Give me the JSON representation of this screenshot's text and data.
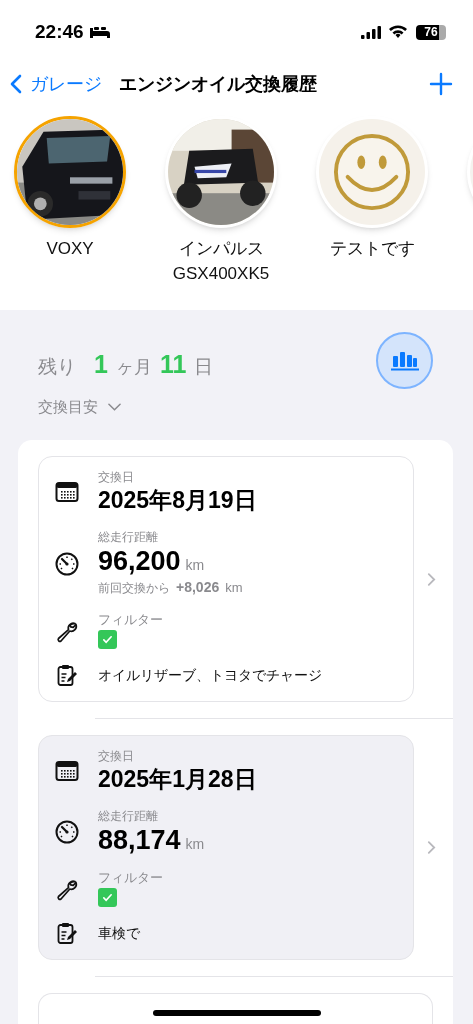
{
  "status_bar": {
    "time": "22:46",
    "battery": "76"
  },
  "nav": {
    "back": "ガレージ",
    "title": "エンジンオイル交換履歴"
  },
  "vehicles": [
    {
      "kind": "car",
      "name": "VOXY",
      "selected": true
    },
    {
      "kind": "bike",
      "name": "インパルス\nGSX400XK5",
      "selected": false
    },
    {
      "kind": "smiley",
      "name": "テストです",
      "selected": false
    },
    {
      "kind": "blank",
      "selected": false
    }
  ],
  "remaining": {
    "label": "残り",
    "months": "1",
    "month_unit": "ヶ月",
    "days": "11",
    "day_unit": "日"
  },
  "guide": {
    "label": "交換目安",
    "expanded": false
  },
  "records": [
    {
      "selected": false,
      "date_label": "交換日",
      "date": "2025年8月19日",
      "mileage_label": "総走行距離",
      "mileage": "96,200",
      "unit": "km",
      "since_label": "前回交換から",
      "since": "+8,026",
      "since_unit": "km",
      "filter_label": "フィルター",
      "filter_checked": true,
      "note": "オイルリザーブ、トヨタでチャージ"
    },
    {
      "selected": true,
      "date_label": "交換日",
      "date": "2025年1月28日",
      "mileage_label": "総走行距離",
      "mileage": "88,174",
      "unit": "km",
      "filter_label": "フィルター",
      "filter_checked": true,
      "note": "車検で"
    },
    {
      "kind": "partial",
      "selected": false
    }
  ]
}
